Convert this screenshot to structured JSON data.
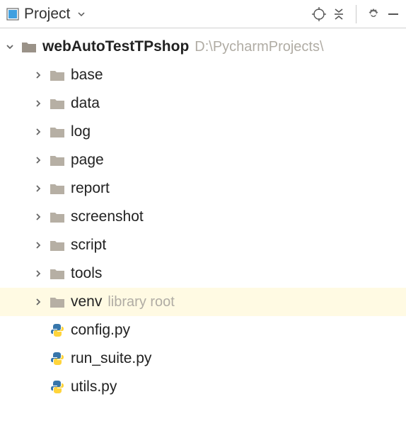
{
  "toolbar": {
    "project_label": "Project"
  },
  "tree": {
    "root": {
      "name": "webAutoTestTPshop",
      "path": "D:\\PycharmProjects\\"
    },
    "folders": [
      {
        "label": "base"
      },
      {
        "label": "data"
      },
      {
        "label": "log"
      },
      {
        "label": "page"
      },
      {
        "label": "report"
      },
      {
        "label": "screenshot"
      },
      {
        "label": "script"
      },
      {
        "label": "tools"
      },
      {
        "label": "venv",
        "hint": "library root",
        "highlight": true
      }
    ],
    "files": [
      {
        "label": "config.py"
      },
      {
        "label": "run_suite.py"
      },
      {
        "label": "utils.py"
      }
    ]
  }
}
